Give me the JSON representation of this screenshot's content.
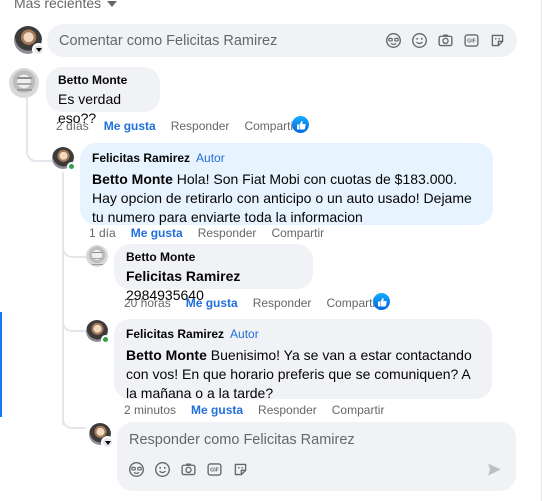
{
  "header": {
    "sort_label": "Más recientes"
  },
  "composer": {
    "placeholder": "Comentar como Felicitas Ramirez"
  },
  "composer_icons": [
    "avatar-sticker-icon",
    "emoji-icon",
    "camera-icon",
    "gif-icon",
    "sticker-icon"
  ],
  "comments": [
    {
      "author": "Betto Monte",
      "text": "Es verdad eso??",
      "time": "2 días",
      "like": "Me gusta",
      "reply": "Responder",
      "share": "Compartir",
      "reaction": "like"
    },
    {
      "author": "Felicitas Ramirez",
      "tag": "Autor",
      "mention": "Betto Monte",
      "text": " Hola! Son Fiat Mobi con cuotas de $183.000. Hay opcion de retirarlo con anticipo o un auto usado! Dejame tu numero para enviarte toda la informacion",
      "time": "1 día",
      "like": "Me gusta",
      "reply": "Responder",
      "share": "Compartir"
    },
    {
      "author": "Betto Monte",
      "mention": "Felicitas Ramirez",
      "text": " 2984935640",
      "time": "20 horas",
      "like": "Me gusta",
      "reply": "Responder",
      "share": "Compartir",
      "reaction": "like"
    },
    {
      "author": "Felicitas Ramirez",
      "tag": "Autor",
      "mention": "Betto Monte",
      "text": " Buenisimo! Ya se van a estar contactando con vos! En que horario preferis que se comuniquen? A la mañana o a la tarde?",
      "time": "2 minutos",
      "like": "Me gusta",
      "reply": "Responder",
      "share": "Compartir"
    }
  ],
  "reply_box": {
    "placeholder": "Responder como Felicitas Ramirez"
  },
  "colors": {
    "accent": "#216fdb",
    "bubble": "#f0f2f5",
    "bubble_highlight": "#e7f3ff",
    "online": "#31a24c"
  }
}
